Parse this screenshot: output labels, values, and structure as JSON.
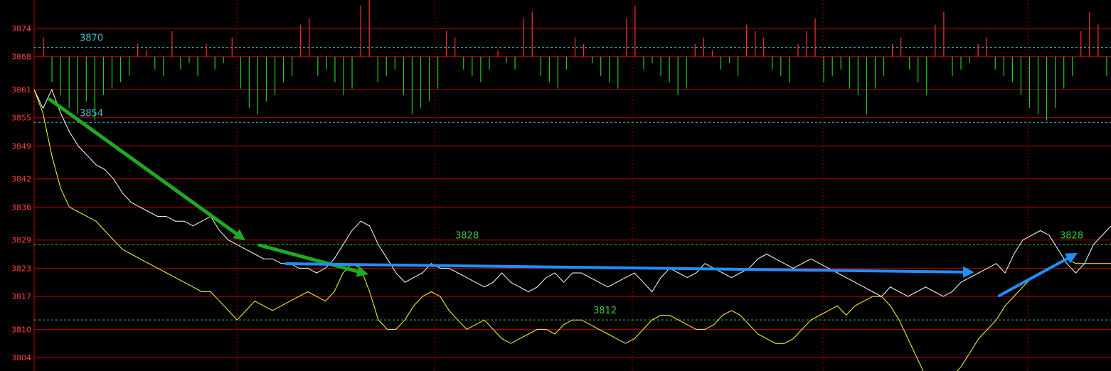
{
  "chart_data": {
    "type": "line",
    "y_ticks": [
      3874,
      3868,
      3861,
      3855,
      3849,
      3842,
      3836,
      3829,
      3823,
      3817,
      3810,
      3804
    ],
    "ylim": [
      3802,
      3881
    ],
    "grid": true,
    "colors": {
      "background": "#000000",
      "grid_horizontal": "#c00000",
      "grid_vertical": "#8b0000",
      "tick_text": "#ff4040",
      "price_line": "#ffffff",
      "avg_line": "#ffff33",
      "volume_up": "#ff3030",
      "volume_down": "#22cc22",
      "ref_cyan": "#40c0d0",
      "ref_green": "#33cc33",
      "arrow_green": "#1faa1f",
      "arrow_blue": "#1e90ff"
    },
    "reference_lines": [
      {
        "label": "3870",
        "value": 3870,
        "color": "#40c0d0"
      },
      {
        "label": "3854",
        "value": 3854,
        "color": "#40c0d0"
      },
      {
        "label": "3828",
        "value": 3828,
        "color": "#33cc33"
      },
      {
        "label": "3812",
        "value": 3812,
        "color": "#33cc33"
      }
    ],
    "annotations": [
      {
        "text": "3870",
        "value": 3870,
        "color": "#40c0d0",
        "at": "left"
      },
      {
        "text": "3854",
        "value": 3854,
        "color": "#40c0d0",
        "at": "left"
      },
      {
        "text": "3828",
        "value": 3828,
        "color": "#33cc33",
        "at": "center-left"
      },
      {
        "text": "3812",
        "value": 3812,
        "color": "#33cc33",
        "at": "center"
      },
      {
        "text": "3828",
        "value": 3828,
        "color": "#33cc33",
        "at": "right"
      }
    ],
    "series": [
      {
        "color": "#ffffff",
        "values": [
          3861,
          3857,
          3861,
          3856,
          3852,
          3849,
          3847,
          3845,
          3844,
          3842,
          3839,
          3837,
          3836,
          3835,
          3834,
          3834,
          3833,
          3833,
          3832,
          3833,
          3834,
          3831,
          3829,
          3828,
          3827,
          3826,
          3825,
          3825,
          3824,
          3824,
          3823,
          3823,
          3822,
          3823,
          3825,
          3828,
          3831,
          3833,
          3832,
          3828,
          3825,
          3822,
          3820,
          3821,
          3822,
          3824,
          3823,
          3823,
          3822,
          3821,
          3820,
          3819,
          3820,
          3822,
          3820,
          3819,
          3818,
          3819,
          3821,
          3822,
          3820,
          3822,
          3822,
          3821,
          3820,
          3819,
          3820,
          3821,
          3822,
          3820,
          3818,
          3821,
          3823,
          3822,
          3821,
          3822,
          3824,
          3823,
          3822,
          3821,
          3822,
          3823,
          3825,
          3826,
          3825,
          3824,
          3823,
          3824,
          3825,
          3824,
          3823,
          3822,
          3821,
          3820,
          3819,
          3818,
          3817,
          3819,
          3818,
          3817,
          3818,
          3819,
          3818,
          3817,
          3818,
          3820,
          3821,
          3822,
          3823,
          3824,
          3822,
          3826,
          3829,
          3830,
          3831,
          3830,
          3827,
          3824,
          3822,
          3824,
          3828,
          3830,
          3832
        ]
      },
      {
        "color": "#ffff33",
        "values": [
          3861,
          3856,
          3847,
          3840,
          3836,
          3835,
          3834,
          3833,
          3831,
          3829,
          3827,
          3826,
          3825,
          3824,
          3823,
          3822,
          3821,
          3820,
          3819,
          3818,
          3818,
          3816,
          3814,
          3812,
          3814,
          3816,
          3815,
          3814,
          3815,
          3816,
          3817,
          3818,
          3817,
          3816,
          3818,
          3822,
          3824,
          3823,
          3818,
          3812,
          3810,
          3810,
          3812,
          3815,
          3817,
          3818,
          3817,
          3814,
          3812,
          3810,
          3811,
          3812,
          3810,
          3808,
          3807,
          3808,
          3809,
          3810,
          3810,
          3809,
          3811,
          3812,
          3812,
          3811,
          3810,
          3809,
          3808,
          3807,
          3808,
          3810,
          3812,
          3813,
          3813,
          3812,
          3811,
          3810,
          3810,
          3811,
          3813,
          3814,
          3813,
          3811,
          3809,
          3808,
          3807,
          3807,
          3808,
          3810,
          3812,
          3813,
          3814,
          3815,
          3813,
          3815,
          3816,
          3817,
          3817,
          3815,
          3812,
          3808,
          3804,
          3800,
          3798,
          3798,
          3800,
          3802,
          3805,
          3808,
          3810,
          3812,
          3815,
          3817,
          3819,
          3821,
          3822,
          3823,
          3824,
          3825,
          3824,
          3824,
          3824,
          3824,
          3824
        ]
      }
    ],
    "volume_bars": [
      3,
      -4,
      -6,
      -8,
      -9,
      -7,
      -10,
      -6,
      -5,
      -4,
      -3,
      2,
      1,
      -2,
      -3,
      4,
      -2,
      -1,
      -3,
      2,
      -2,
      -1,
      3,
      -5,
      -8,
      -9,
      -7,
      -6,
      -4,
      -3,
      5,
      6,
      -3,
      -2,
      -4,
      -6,
      -5,
      8,
      9,
      -4,
      -3,
      -2,
      -6,
      -9,
      -8,
      -7,
      -5,
      4,
      3,
      -2,
      -3,
      -4,
      -2,
      1,
      -1,
      -2,
      6,
      7,
      -3,
      -4,
      -5,
      -2,
      3,
      2,
      -1,
      -3,
      -4,
      -5,
      6,
      8,
      -2,
      -1,
      -3,
      -4,
      -6,
      -5,
      2,
      3,
      1,
      -2,
      -1,
      -3,
      5,
      4,
      3,
      -2,
      -3,
      -4,
      2,
      4,
      6,
      -4,
      -3,
      -2,
      -5,
      -6,
      -9,
      -5,
      -3,
      2,
      3,
      -2,
      -4,
      -6,
      5,
      7,
      -3,
      -2,
      -1,
      2,
      3,
      -2,
      -3,
      -4,
      -6,
      -8,
      -9,
      -10,
      -8,
      -5,
      -3,
      4,
      7,
      5,
      -3
    ]
  }
}
